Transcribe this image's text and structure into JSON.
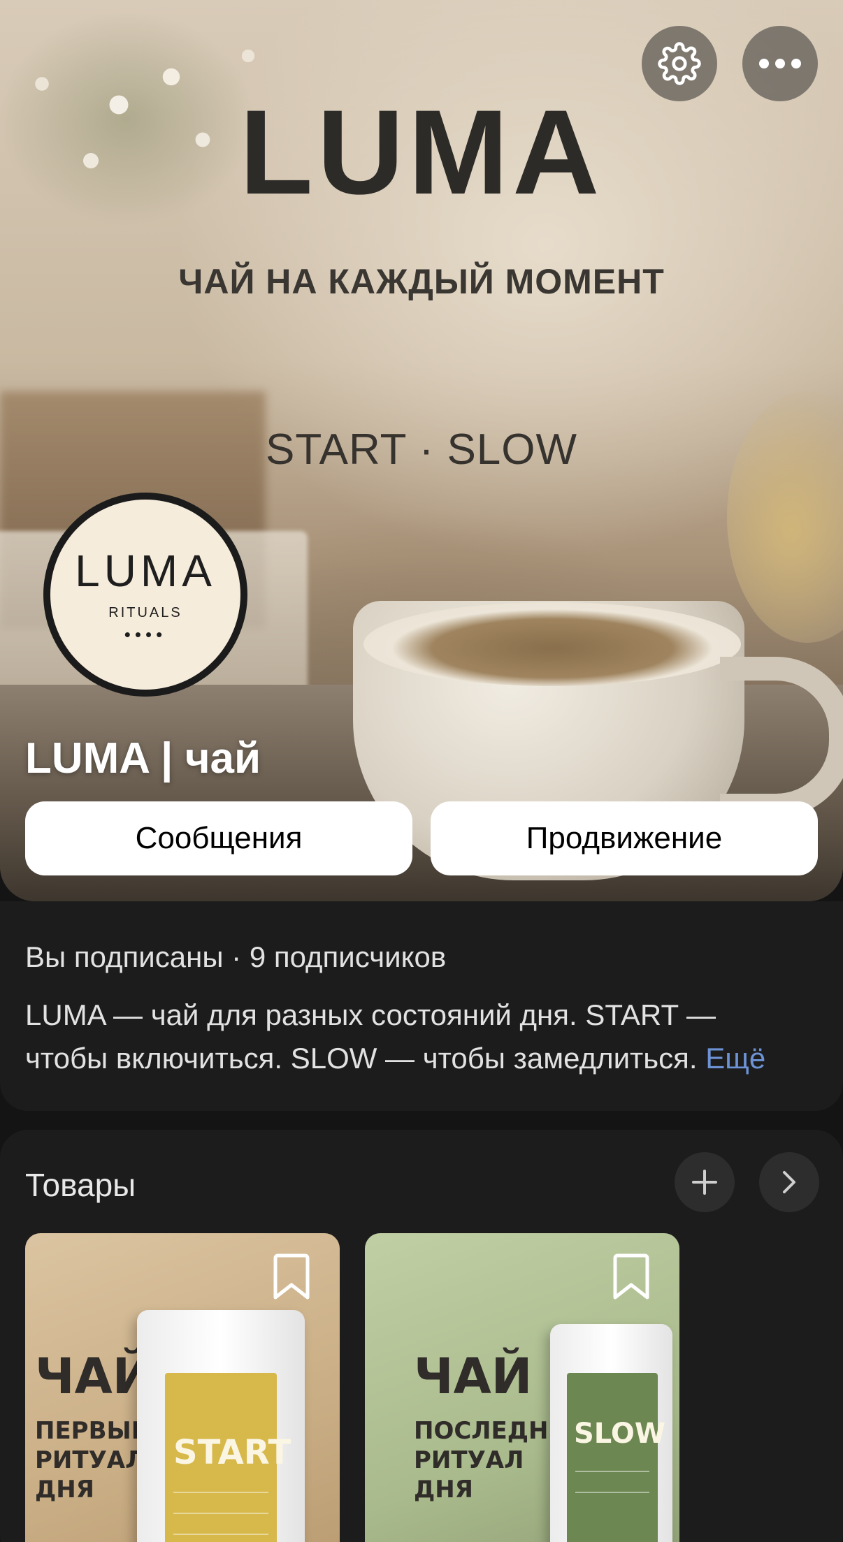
{
  "header": {
    "settings_icon": "gear-icon",
    "more_icon": "more-horizontal-icon"
  },
  "cover": {
    "brand": "LUMA",
    "tagline": "ЧАЙ НА КАЖДЫЙ МОМЕНТ",
    "lines": "START · SLOW"
  },
  "avatar": {
    "logo": "LUMA",
    "subtitle": "RITUALS",
    "dots": "••••"
  },
  "profile": {
    "name": "LUMA | чай",
    "messages_label": "Сообщения",
    "promotion_label": "Продвижение",
    "subscription": "Вы подписаны · 9 подписчиков",
    "description_line1": "LUMA — чай для разных состояний дня. START —",
    "description_line2": "чтобы включиться.  SLOW — чтобы замедлиться. ",
    "more_link": "Ещё"
  },
  "products": {
    "title": "Товары",
    "add_icon": "plus-icon",
    "next_icon": "chevron-right-icon",
    "items": [
      {
        "big": "ЧАЙ",
        "line1": "ПЕРВЫЙ",
        "line2": "РИТУАЛ",
        "line3": "ДНЯ",
        "pack": "START",
        "accent": "#d7b84a"
      },
      {
        "big": "ЧАЙ",
        "line1": "ПОСЛЕДНИЙ",
        "line2": "РИТУАЛ",
        "line3": "ДНЯ",
        "pack": "SLOW",
        "accent": "#6c8751"
      }
    ]
  },
  "colors": {
    "background": "#141414",
    "card": "#1c1c1c",
    "link": "#6d93d6"
  }
}
